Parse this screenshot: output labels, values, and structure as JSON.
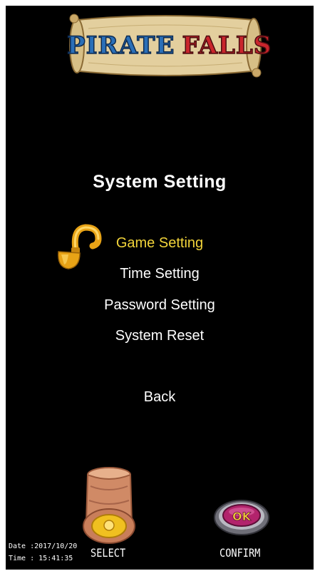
{
  "logo": {
    "word1": "PIRATE",
    "word2": "FALLS"
  },
  "title": "System Setting",
  "menu": {
    "items": [
      {
        "label": "Game Setting",
        "selected": true
      },
      {
        "label": "Time Setting",
        "selected": false
      },
      {
        "label": "Password Setting",
        "selected": false
      },
      {
        "label": "System Reset",
        "selected": false
      }
    ],
    "back": "Back"
  },
  "controls": {
    "select_label": "SELECT",
    "confirm_label": "CONFIRM",
    "ok_text": "OK"
  },
  "status": {
    "date_label": "Date :",
    "date_value": "2017/10/20",
    "time_label": "Time :",
    "time_value": "15:41:35"
  },
  "colors": {
    "background": "#000000",
    "text": "#ffffff",
    "selected": "#f2d43a",
    "hook_gold": "#e8a316"
  },
  "icons": {
    "cursor": "hook-icon",
    "select": "treasure-knob-icon",
    "confirm": "ok-button-icon"
  }
}
